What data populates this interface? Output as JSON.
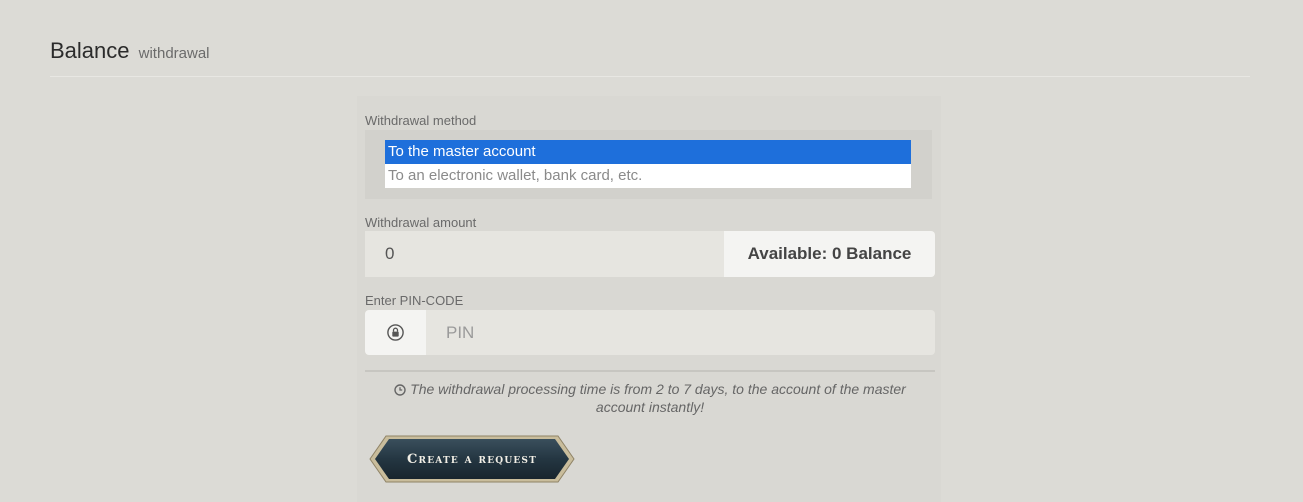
{
  "header": {
    "title": "Balance",
    "subtitle": "withdrawal"
  },
  "method": {
    "label": "Withdrawal method",
    "options": [
      {
        "label": "To the master account",
        "selected": true
      },
      {
        "label": "To an electronic wallet, bank card, etc.",
        "selected": false
      }
    ]
  },
  "amount": {
    "label": "Withdrawal amount",
    "value": "0",
    "available": "Available: 0 Balance"
  },
  "pin": {
    "label": "Enter PIN-CODE",
    "placeholder": "PIN",
    "icon": "lock-icon"
  },
  "note": {
    "icon": "clock-icon",
    "text": "The withdrawal processing time is from 2 to 7 days, to the account of the master account instantly!"
  },
  "actions": {
    "create_label": "Create a request"
  },
  "colors": {
    "selected_option": "#1e6fdb",
    "button_bg": "#243642",
    "button_border": "#b9a984"
  }
}
